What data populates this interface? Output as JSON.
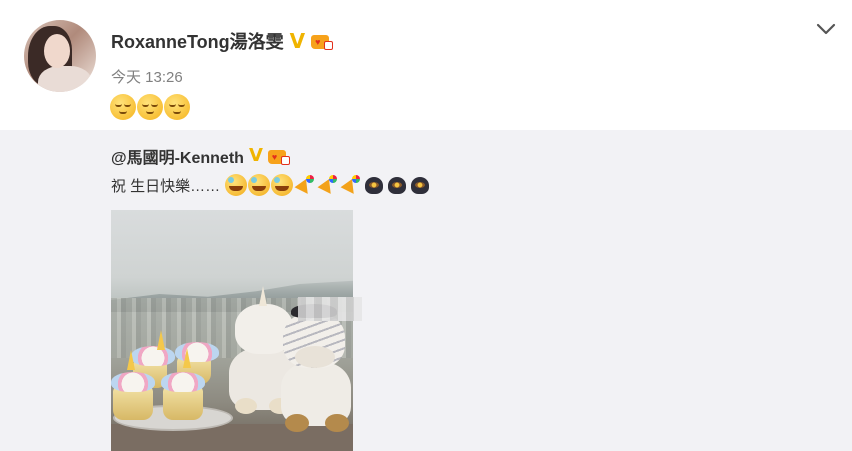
{
  "post": {
    "author": "RoxanneTong湯洛雯",
    "timestamp": "今天 13:26",
    "emojis": [
      "sleepy-smile-icon",
      "sleepy-smile-icon",
      "sleepy-smile-icon"
    ],
    "verified_icon": "V"
  },
  "repost": {
    "author": "@馬國明-Kenneth",
    "verified_icon": "V",
    "text": "祝 生日快樂……",
    "emojis": [
      "laugh-icon",
      "laugh-icon",
      "laugh-icon",
      "party-popper-icon",
      "party-popper-icon",
      "party-popper-icon",
      "cake-icon",
      "cake-icon",
      "cake-icon"
    ]
  },
  "colors": {
    "verified": "#f0b400",
    "repost_background": "#f2f2f5",
    "timestamp": "#808080",
    "text": "#333333"
  }
}
